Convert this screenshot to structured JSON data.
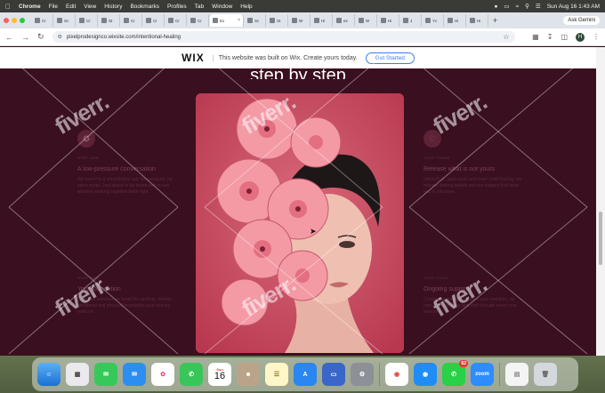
{
  "menubar": {
    "app_name": "Chrome",
    "menus": [
      "File",
      "Edit",
      "View",
      "History",
      "Bookmarks",
      "Profiles",
      "Tab",
      "Window",
      "Help"
    ],
    "datetime": "Sun Aug 16  1:43 AM"
  },
  "browser": {
    "tabs": [
      {
        "label": "Cr"
      },
      {
        "label": "Sc"
      },
      {
        "label": "Cr"
      },
      {
        "label": "St"
      },
      {
        "label": "Cr"
      },
      {
        "label": "Cr"
      },
      {
        "label": "Cr"
      },
      {
        "label": "Cr"
      },
      {
        "label": "Ex",
        "active": true
      },
      {
        "label": "Sc"
      },
      {
        "label": "St"
      },
      {
        "label": "W"
      },
      {
        "label": "Hi"
      },
      {
        "label": "ex"
      },
      {
        "label": "W"
      },
      {
        "label": "Hi"
      },
      {
        "label": "J"
      },
      {
        "label": "Yc"
      },
      {
        "label": "Hi"
      },
      {
        "label": "Hi"
      }
    ],
    "new_tab_symbol": "+",
    "ask_gemini": "Ask Gemini",
    "url": "pixelprodesignco.wixsite.com/intentional-healing",
    "profile_initial": "H"
  },
  "wix_banner": {
    "logo": "WIX",
    "message": "This website was built on Wix. Create yours today.",
    "button": "Get Started"
  },
  "page": {
    "section_title": "step by step",
    "cards": [
      {
        "step": "STEP ONE",
        "heading": "A low-pressure conversation",
        "body": "We meet for a consultation call. No pressure, no sales script. Just space to be heard and to see whether working together feels right."
      },
      {
        "step": "STEP THREE",
        "heading": "Release what is not yours",
        "body": "Using BLR, parts work and inner child healing, we release limiting beliefs and the triggers that keep you in old loops."
      },
      {
        "step": "STEP TWO",
        "heading": "Your foundation",
        "body": "Over two sessions we build the spiritual, mental, emotional and physical foundation your healing rests on."
      },
      {
        "step": "STEP FOUR",
        "heading": "Ongoing support",
        "body": "Continued sessions support your evolution, as new layers surface and shift through every new season."
      }
    ]
  },
  "watermark": "fiverr.",
  "dock": {
    "calendar_month": "Sun",
    "calendar_day": "16",
    "whatsapp_badge": "62",
    "zoom_label": "zoom"
  },
  "colors": {
    "page_bg": "#3a0f1f",
    "portrait_bg": "#c94f63",
    "wix_blue": "#3b7df0"
  }
}
